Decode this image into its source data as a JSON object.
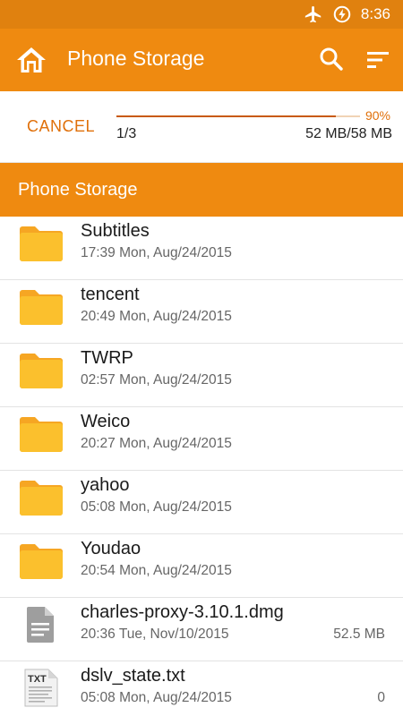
{
  "status_bar": {
    "time": "8:36",
    "icons": [
      "airplane-icon",
      "battery-saver-icon"
    ]
  },
  "app_bar": {
    "title": "Phone Storage",
    "icons": [
      "home-icon",
      "search-icon",
      "sort-icon"
    ]
  },
  "progress": {
    "cancel_label": "CANCEL",
    "percent_label": "90%",
    "percent_value": 0.9,
    "count": "1/3",
    "size": "52 MB/58 MB"
  },
  "section": {
    "title": "Phone Storage"
  },
  "files": [
    {
      "name": "Subtitles",
      "date": "17:39 Mon, Aug/24/2015",
      "size": "",
      "type": "folder"
    },
    {
      "name": "tencent",
      "date": "20:49 Mon, Aug/24/2015",
      "size": "",
      "type": "folder"
    },
    {
      "name": "TWRP",
      "date": "02:57 Mon, Aug/24/2015",
      "size": "",
      "type": "folder"
    },
    {
      "name": "Weico",
      "date": "20:27 Mon, Aug/24/2015",
      "size": "",
      "type": "folder"
    },
    {
      "name": "yahoo",
      "date": "05:08 Mon, Aug/24/2015",
      "size": "",
      "type": "folder"
    },
    {
      "name": "Youdao",
      "date": "20:54 Mon, Aug/24/2015",
      "size": "",
      "type": "folder"
    },
    {
      "name": "charles-proxy-3.10.1.dmg",
      "date": "20:36 Tue, Nov/10/2015",
      "size": "52.5 MB",
      "type": "file"
    },
    {
      "name": "dslv_state.txt",
      "date": "05:08 Mon, Aug/24/2015",
      "size": "0",
      "type": "txt"
    }
  ],
  "colors": {
    "accent": "#ef8a10",
    "status_bar": "#e0810f",
    "folder": "#fbbd2e",
    "cancel_text": "#e0700a"
  }
}
